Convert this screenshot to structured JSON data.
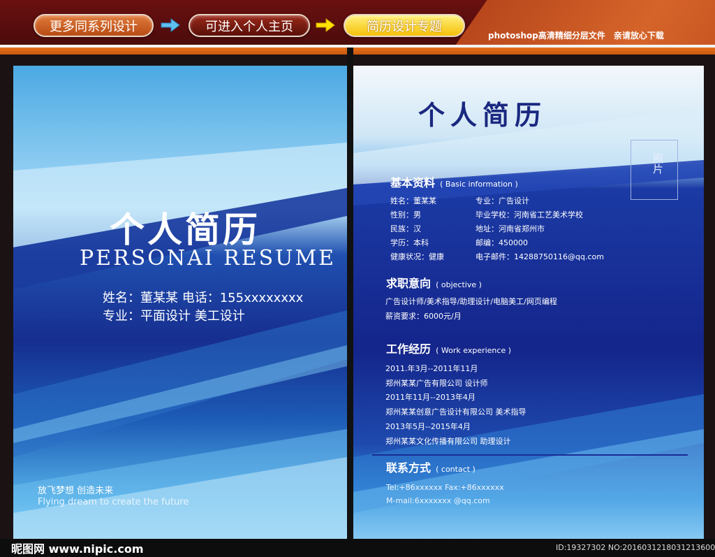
{
  "banner": {
    "btn_more": "更多同系列设计",
    "btn_home": "可进入个人主页",
    "btn_topic": "简历设计专题",
    "note": "photoshop高清精细分层文件　亲请放心下载"
  },
  "left_page": {
    "title": "个人简历",
    "subtitle": "PERSONAI RESUME",
    "line1": "姓名：董某某 电话：155xxxxxxxx",
    "line2": "专业：平面设计 美工设计",
    "slogan_cn": "放飞梦想  创造未来",
    "slogan_en": "Flying dream to create the future"
  },
  "right_page": {
    "title": "个人简历",
    "photo_label": "照片",
    "basic": {
      "heading": "基本资料",
      "heading_en": "( Basic information )",
      "left_col": [
        "姓名：董某某",
        "性别：男",
        "民族：汉",
        "学历：本科",
        "健康状况：健康"
      ],
      "right_col": [
        "专业：广告设计",
        "毕业学校：河南省工艺美术学校",
        "地址：河南省郑州市",
        "邮编：450000",
        "电子邮件：14288750116@qq.com"
      ]
    },
    "objective": {
      "heading": "求职意向",
      "heading_en": "( objective )",
      "lines": [
        "广告设计师/美术指导/助理设计/电脑美工/网页编程",
        "薪资要求：6000元/月"
      ]
    },
    "experience": {
      "heading": "工作经历",
      "heading_en": "( Work experience )",
      "lines": [
        "2011.年3月--2011年11月",
        "郑州某某广告有限公司  设计师",
        "2011年11月--2013年4月",
        "郑州某某创意广告设计有限公司  美术指导",
        "2013年5月--2015年4月",
        "郑州某某文化传播有限公司 助理设计"
      ]
    },
    "contact": {
      "heading": "联系方式",
      "heading_en": "( contact )",
      "lines": [
        "Tel:+86xxxxxx Fax:+86xxxxxx",
        "M-mail:6xxxxxxx @qq.com"
      ]
    }
  },
  "footer": {
    "watermark": "昵图网 www.nipic.com",
    "id_text": "ID:19327302 NO:20160312180312136001"
  },
  "colors": {
    "banner_bg": "#5a0d0d",
    "accent_orange": "#e3701d",
    "deep_blue": "#14258b",
    "title_blue": "#1a2880"
  }
}
